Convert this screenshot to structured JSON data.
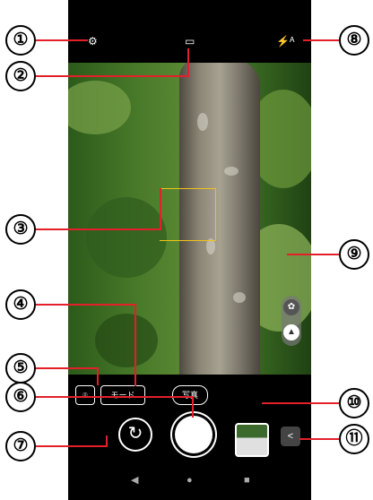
{
  "callouts": [
    "①",
    "②",
    "③",
    "④",
    "⑤",
    "⑥",
    "⑦",
    "⑧",
    "⑨",
    "⑩",
    "⑪"
  ],
  "top_bar": {
    "settings_icon": "⚙",
    "video_icon": "▭",
    "flash_icon": "⚡ᴬ"
  },
  "scene_buttons": {
    "portrait_icon": "✿",
    "landscape_icon": "▲"
  },
  "bottom": {
    "lens_icon": "⌾",
    "mode_label": "モード",
    "photo_label": "写真",
    "switch_icon": "↻",
    "share_icon": "<"
  },
  "nav": {
    "back": "◀",
    "home": "●",
    "recent": "■"
  },
  "colors": {
    "callout_line": "#e3202a",
    "focus_frame": "#f2c21a"
  }
}
